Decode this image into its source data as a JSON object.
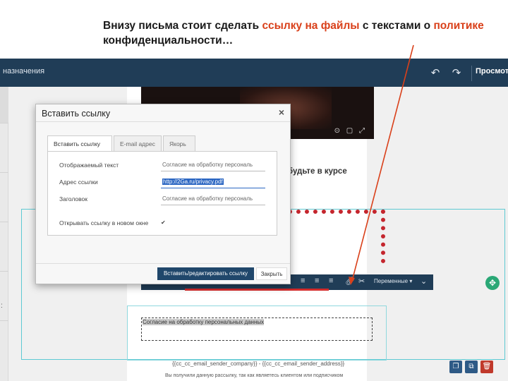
{
  "caption": {
    "part1": "Внизу письма стоит сделать ",
    "highlight1": "ссылку на файлы",
    "part2": " с текстами о ",
    "highlight2": "политике",
    "part3": " конфиденциальности…"
  },
  "topbar": {
    "title": "назначения",
    "undo_icon": "undo-icon",
    "redo_icon": "redo-icon",
    "preview_label": "Просмотр"
  },
  "editor": {
    "course_title": "будьте в курсе",
    "dashed_text": "Согласие на обработку персональных данных",
    "merge_line": "{{cc_cc_email_sender_company}} - {{cc_cc_email_sender_address}}",
    "footer_line": "Вы получили данную рассылку, так как являетесь клиентом или подписчиком",
    "variables_label": "Переменные",
    "move_icon": "move-icon",
    "copy_icon": "copy-icon",
    "duplicate_icon": "duplicate-icon",
    "delete_icon": "trash-icon",
    "colors": {
      "topbar": "#203d57",
      "accent": "#2aa876",
      "delete": "#c0392b"
    }
  },
  "dialog": {
    "title": "Вставить ссылку",
    "close_glyph": "×",
    "tabs": [
      {
        "label": "Вставить ссылку",
        "active": true
      },
      {
        "label": "E-mail адрес",
        "active": false
      },
      {
        "label": "Якорь",
        "active": false
      }
    ],
    "fields": {
      "display_text_label": "Отображаемый текст",
      "display_text_value": "Согласие на обработку персональ",
      "url_label": "Адрес ссылки",
      "url_value": "http://2Ga.ru/privacy.pdf",
      "title_label": "Заголовок",
      "title_value": "Согласие на обработку персональ",
      "new_window_label": "Открывать ссылку в новом окне",
      "new_window_checked": true
    },
    "submit_label": "Вставить/редактировать ссылку",
    "cancel_label": "Закрыть"
  }
}
